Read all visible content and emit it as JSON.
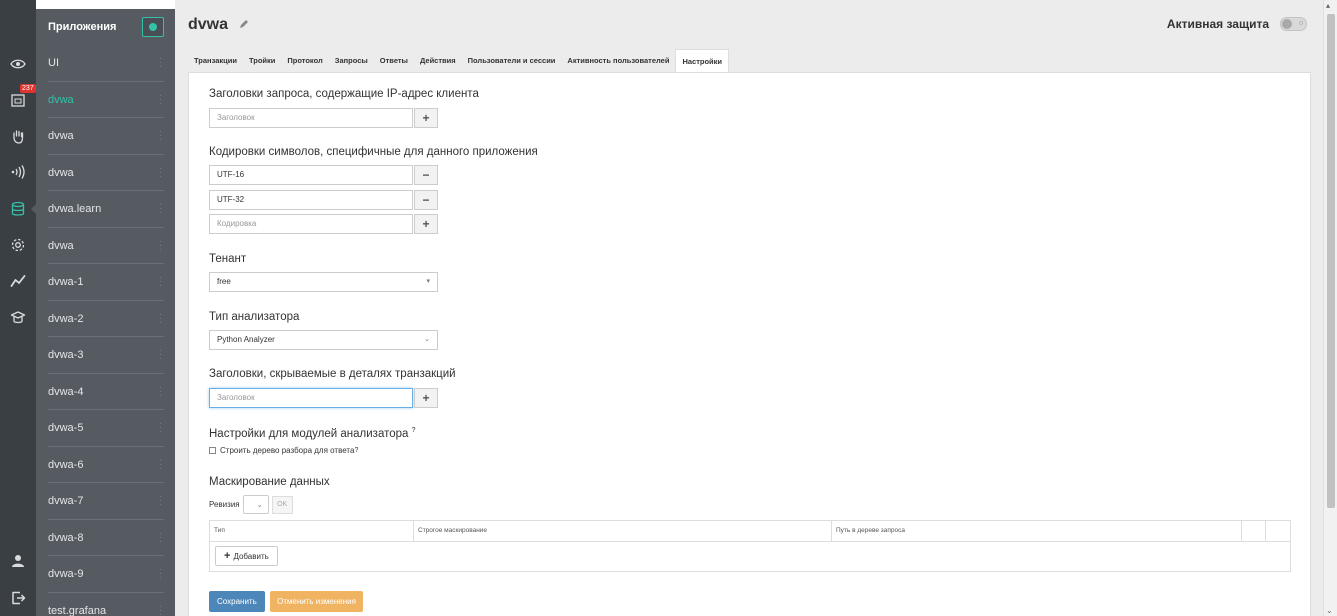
{
  "sidebar": {
    "title": "Приложения",
    "apps": [
      {
        "label": "UI"
      },
      {
        "label": "dvwa"
      },
      {
        "label": "dvwa"
      },
      {
        "label": "dvwa"
      },
      {
        "label": "dvwa.learn"
      },
      {
        "label": "dvwa"
      },
      {
        "label": "dvwa-1"
      },
      {
        "label": "dvwa-2"
      },
      {
        "label": "dvwa-3"
      },
      {
        "label": "dvwa-4"
      },
      {
        "label": "dvwa-5"
      },
      {
        "label": "dvwa-6"
      },
      {
        "label": "dvwa-7"
      },
      {
        "label": "dvwa-8"
      },
      {
        "label": "dvwa-9"
      },
      {
        "label": "test.grafana"
      }
    ],
    "selected_index": 1
  },
  "rail": {
    "icons": [
      "eye-icon",
      "events-icon",
      "hand-icon",
      "signal-icon",
      "database-icon",
      "gear-icon",
      "chart-icon",
      "learn-icon",
      "user-icon",
      "logout-icon"
    ],
    "badge": "237"
  },
  "header": {
    "title": "dvwa",
    "protection_label": "Активная защита",
    "toggle_off_glyph": "o"
  },
  "tabs": [
    {
      "label": "Транзакции"
    },
    {
      "label": "Тройки"
    },
    {
      "label": "Протокол"
    },
    {
      "label": "Запросы"
    },
    {
      "label": "Ответы"
    },
    {
      "label": "Действия"
    },
    {
      "label": "Пользователи и сессии"
    },
    {
      "label": "Активность пользователей"
    },
    {
      "label": "Настройки"
    }
  ],
  "active_tab": "Настройки",
  "settings": {
    "ip_headers": {
      "title": "Заголовки запроса, содержащие IP-адрес клиента",
      "placeholder": "Заголовок"
    },
    "encodings": {
      "title": "Кодировки символов, специфичные для данного приложения",
      "values": [
        "UTF-16",
        "UTF-32"
      ],
      "placeholder": "Кодировка"
    },
    "tenant": {
      "title": "Тенант",
      "value": "free"
    },
    "analyzer": {
      "title": "Тип анализатора",
      "value": "Python Analyzer"
    },
    "hidden_headers": {
      "title": "Заголовки, скрываемые в деталях транзакций",
      "placeholder": "Заголовок"
    },
    "modules": {
      "title": "Настройки для модулей анализатора",
      "checkbox_label": "Строить дерево разбора для ответа",
      "help": "?"
    },
    "masking": {
      "title": "Маскирование данных",
      "revision_label": "Ревизия",
      "ok_label": "OK",
      "columns": [
        "Тип",
        "Строгое маскирование",
        "Путь в дереве запроса"
      ],
      "add_label": "Добавить"
    },
    "buttons": {
      "save": "Сохранить",
      "cancel": "Отменить изменения"
    }
  },
  "colors": {
    "accent": "#35c1a8",
    "sidebar_bg": "#555b61",
    "rail_bg": "#3a3f44",
    "primary_btn": "#4d86b9",
    "warning_btn": "#f0b361",
    "badge": "#e0342f"
  }
}
